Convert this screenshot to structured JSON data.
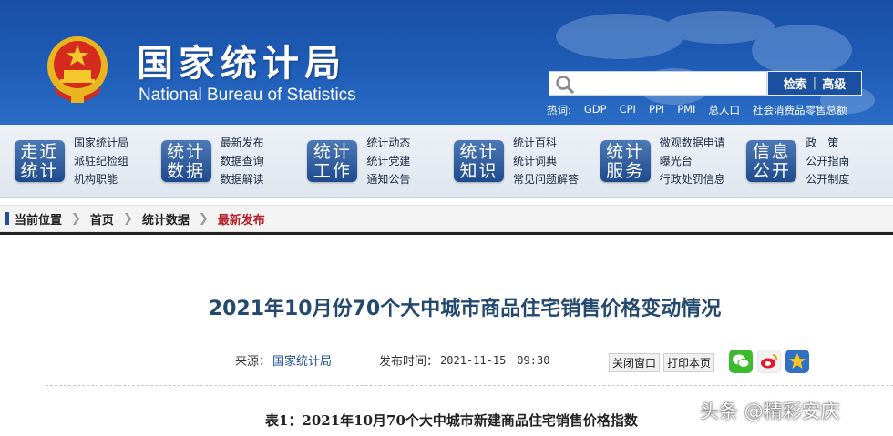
{
  "header": {
    "site_title": "国家统计局",
    "site_subtitle": "National Bureau of Statistics",
    "search": {
      "placeholder": "",
      "search_label": "检索",
      "advanced_label": "高级"
    },
    "hot_label": "热词:",
    "hot_words": [
      "GDP",
      "CPI",
      "PPI",
      "PMI",
      "总人口",
      "社会消费品零售总额"
    ]
  },
  "nav": [
    {
      "badge": [
        "走近",
        "统计"
      ],
      "links": [
        "国家统计局",
        "派驻纪检组",
        "机构职能"
      ]
    },
    {
      "badge": [
        "统计",
        "数据"
      ],
      "links": [
        "最新发布",
        "数据查询",
        "数据解读"
      ]
    },
    {
      "badge": [
        "统计",
        "工作"
      ],
      "links": [
        "统计动态",
        "统计党建",
        "通知公告"
      ]
    },
    {
      "badge": [
        "统计",
        "知识"
      ],
      "links": [
        "统计百科",
        "统计词典",
        "常见问题解答"
      ]
    },
    {
      "badge": [
        "统计",
        "服务"
      ],
      "links": [
        "微观数据申请",
        "曝光台",
        "行政处罚信息"
      ]
    },
    {
      "badge": [
        "信息",
        "公开"
      ],
      "links": [
        "政　策",
        "公开指南",
        "公开制度"
      ]
    }
  ],
  "breadcrumb": {
    "label": "当前位置",
    "items": [
      "首页",
      "统计数据"
    ],
    "current": "最新发布"
  },
  "article": {
    "title": "2021年10月份70个大中城市商品住宅销售价格变动情况",
    "source_label": "来源：",
    "source": "国家统计局",
    "time_label": "发布时间：",
    "time": "2021-11-15　09:30",
    "close_label": "关闭窗口",
    "print_label": "打印本页",
    "table_caption": "表1：2021年10月70个大中城市新建商品住宅销售价格指数"
  },
  "watermark": "头条 @精彩安庆",
  "colors": {
    "header_blue": "#1d5ab4",
    "badge_blue": "#1e4b8e",
    "title_blue": "#24496f",
    "current_red": "#b7202a"
  }
}
